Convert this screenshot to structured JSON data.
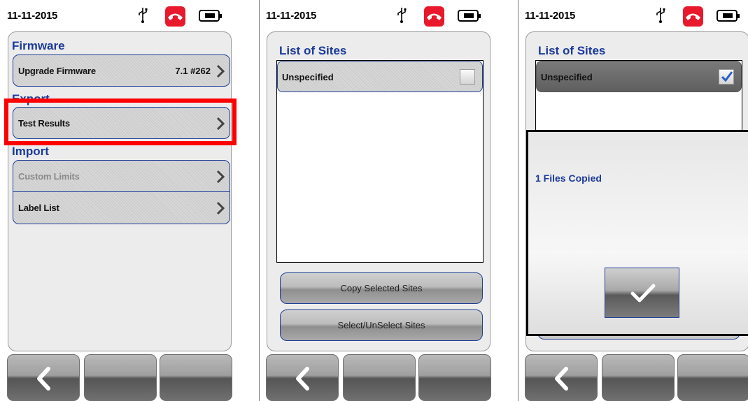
{
  "colors": {
    "accent_blue": "#1b3a9a",
    "alert_red": "#ff0000",
    "phone_red": "#e8192c"
  },
  "screens": [
    {
      "date": "11-11-2015",
      "status_icons": [
        "usb-icon",
        "phone-hangup-icon",
        "battery-icon"
      ],
      "sections": {
        "firmware": {
          "title": "Firmware",
          "upgrade": {
            "label": "Upgrade Firmware",
            "value": "7.1  #262"
          }
        },
        "export": {
          "title": "Export",
          "test_results": {
            "label": "Test Results"
          }
        },
        "import": {
          "title": "Import",
          "custom_limits": {
            "label": "Custom Limits",
            "disabled": true
          },
          "label_list": {
            "label": "Label List"
          }
        }
      },
      "softkeys": [
        "back-icon",
        "",
        ""
      ]
    },
    {
      "date": "11-11-2015",
      "status_icons": [
        "usb-icon",
        "phone-hangup-icon",
        "battery-icon"
      ],
      "list_title": "List of Sites",
      "sites": [
        {
          "label": "Unspecified",
          "checked": false
        }
      ],
      "copy_button": "Copy Selected Sites",
      "select_button": "Select/UnSelect Sites",
      "softkeys": [
        "back-icon",
        "",
        ""
      ]
    },
    {
      "date": "11-11-2015",
      "status_icons": [
        "usb-icon",
        "phone-hangup-icon",
        "battery-icon"
      ],
      "list_title": "List of Sites",
      "sites": [
        {
          "label": "Unspecified",
          "checked": true
        }
      ],
      "dialog": {
        "message": "1 Files Copied",
        "ok_icon": "checkmark-icon"
      },
      "softkeys": [
        "back-icon",
        "",
        ""
      ]
    }
  ]
}
